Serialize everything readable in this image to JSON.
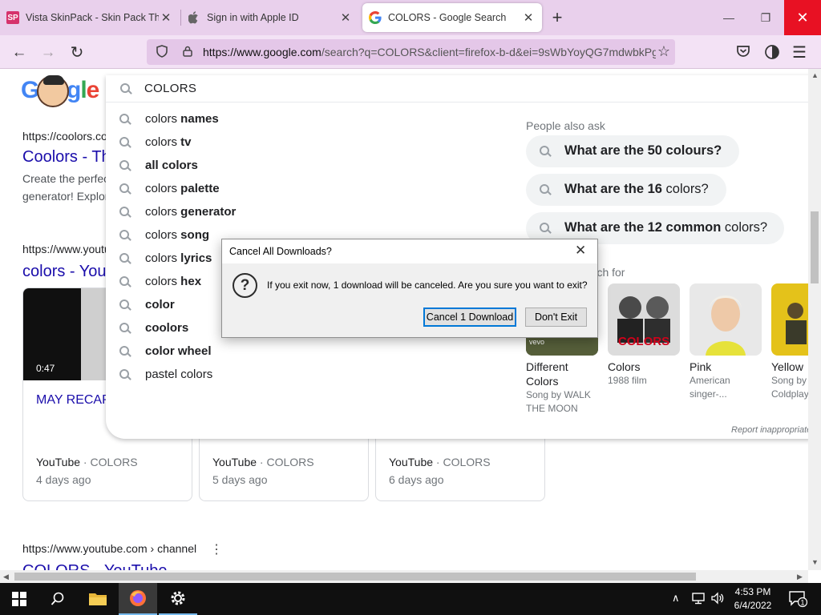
{
  "browser": {
    "tabs": [
      {
        "title": "Vista SkinPack - Skin Pack Them",
        "favicon": "skinpack-icon",
        "active": false
      },
      {
        "title": "Sign in with Apple ID",
        "favicon": "apple-icon",
        "active": false
      },
      {
        "title": "COLORS - Google Search",
        "favicon": "google-icon",
        "active": true
      }
    ],
    "new_tab_label": "+",
    "url_host": "https://www.google.com",
    "url_path": "/search?q=COLORS&client=firefox-b-d&ei=9sWbYoyQG7mdwbkPg"
  },
  "search": {
    "query": "COLORS",
    "suggestions": [
      {
        "prefix": "colors",
        "bold": " names"
      },
      {
        "prefix": "colors",
        "bold": " tv"
      },
      {
        "prefix": "",
        "bold": "all colors"
      },
      {
        "prefix": "colors",
        "bold": " palette"
      },
      {
        "prefix": "colors",
        "bold": " generator"
      },
      {
        "prefix": "colors",
        "bold": " song"
      },
      {
        "prefix": "colors",
        "bold": " lyrics"
      },
      {
        "prefix": "colors",
        "bold": " hex"
      },
      {
        "prefix": "",
        "bold": "color"
      },
      {
        "prefix": "",
        "bold": "coolors"
      },
      {
        "prefix": "",
        "bold": "color wheel"
      },
      {
        "prefix": "pastel colors",
        "bold": ""
      }
    ],
    "people_also_ask_title": "People also ask",
    "people_also_ask": [
      {
        "bold": "What are the 50 colours?",
        "rest": ""
      },
      {
        "bold": "What are the 16 ",
        "rest": "colors?"
      },
      {
        "bold": "What are the 12 common ",
        "rest": "colors?"
      }
    ],
    "people_search_title": "arch for",
    "people_search": [
      {
        "name": "Different Colors",
        "sub": "Song by WALK THE MOON",
        "thumb_label": "vevo"
      },
      {
        "name": "Colors",
        "sub": "1988 film",
        "thumb_label": "COLORS"
      },
      {
        "name": "Pink",
        "sub": "American singer-..."
      },
      {
        "name": "Yellow",
        "sub": "Song by Coldplay"
      }
    ],
    "report_text": "Report inappropriate predictions"
  },
  "results": {
    "result1_url": "https://coolors.co",
    "result1_title": "Coolors - The super fast color palettes generator!",
    "result1_snippet1": "Create the perfect palette or get inspired by thousands of beautiful color schemes.",
    "result1_snippet2": "generator! Explore",
    "result2_url": "https://www.youtube.com",
    "result2_title": "colors - YouTube",
    "videos": [
      {
        "duration": "0:47",
        "title": "MAY RECAP",
        "source": "YouTube",
        "channel": " · COLORS",
        "date": "4 days ago"
      },
      {
        "duration": "",
        "title": "",
        "source": "YouTube",
        "channel": " · COLORS",
        "date": "5 days ago"
      },
      {
        "duration": "",
        "title": "",
        "source": "YouTube",
        "channel": " · COLORS",
        "date": "6 days ago"
      }
    ],
    "result3_url": "https://www.youtube.com › channel",
    "result3_title": "COLORS - YouTube"
  },
  "dialog": {
    "title": "Cancel All Downloads?",
    "message": "If you exit now, 1 download will be canceled. Are you sure you want to exit?",
    "cancel_button": "Cancel 1 Download",
    "dont_exit_button": "Don't Exit"
  },
  "taskbar": {
    "time": "4:53 PM",
    "date": "6/4/2022",
    "notification_count": "1"
  },
  "colors": {
    "tab_strip": "#e9d0ec",
    "toolbar": "#f3e2f5",
    "link": "#1a0dab",
    "close_red": "#e81123",
    "focus_blue": "#0078d7"
  }
}
